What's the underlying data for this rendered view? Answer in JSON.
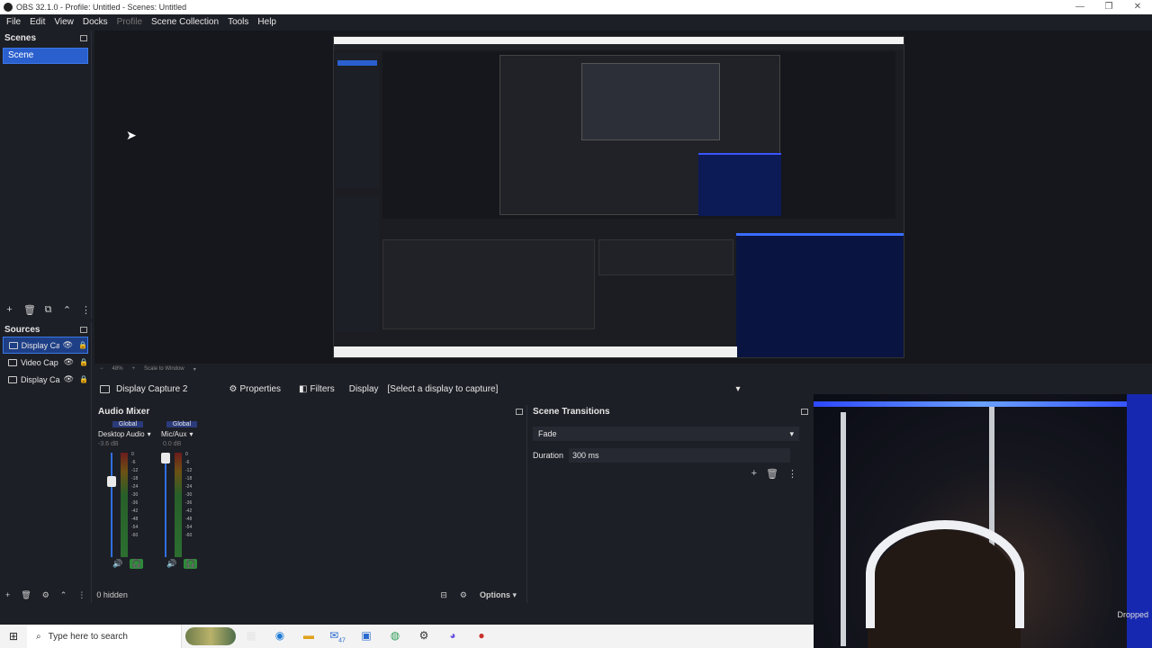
{
  "window": {
    "title": "OBS 32.1.0 - Profile: Untitled - Scenes: Untitled",
    "controls": [
      "—",
      "❐",
      "✕"
    ]
  },
  "menu": {
    "items": [
      "File",
      "Edit",
      "View",
      "Docks",
      "Profile",
      "Scene Collection",
      "Tools",
      "Help"
    ]
  },
  "scenes": {
    "title": "Scenes",
    "items": [
      "Scene"
    ],
    "toolbar_icons": [
      "+",
      "🗑",
      "⧉",
      "⌃",
      "⋮"
    ]
  },
  "sources": {
    "title": "Sources",
    "items": [
      {
        "name": "Display Ca"
      },
      {
        "name": "Video Cap"
      },
      {
        "name": "Display Ca"
      }
    ]
  },
  "preview": {
    "zoom_text": "48%",
    "scale_mode": "Scale to Window"
  },
  "context_bar": {
    "source_name": "Display Capture 2",
    "properties_label": "Properties",
    "filters_label": "Filters",
    "display_label": "Display",
    "display_value": "[Select a display to capture]"
  },
  "audio_mixer": {
    "title": "Audio Mixer",
    "channels": [
      {
        "badge": "Global",
        "name": "Desktop Audio",
        "db": "-3.6 dB",
        "level": 0.75
      },
      {
        "badge": "Global",
        "name": "Mic/Aux",
        "db": "0.0 dB",
        "level": 1.0
      }
    ],
    "scale": [
      "0",
      "-6",
      "-12",
      "-18",
      "-24",
      "-30",
      "-36",
      "-42",
      "-48",
      "-54",
      "-60"
    ]
  },
  "scene_transitions": {
    "title": "Scene Transitions",
    "transition": "Fade",
    "duration_label": "Duration",
    "duration_value": "300 ms"
  },
  "bottom_bar": {
    "hidden_text": "0 hidden",
    "options_label": "Options"
  },
  "webcam": {
    "overlay_text": "Dropped"
  },
  "taskbar": {
    "search_placeholder": "Type here to search",
    "mail_badge": "47"
  }
}
